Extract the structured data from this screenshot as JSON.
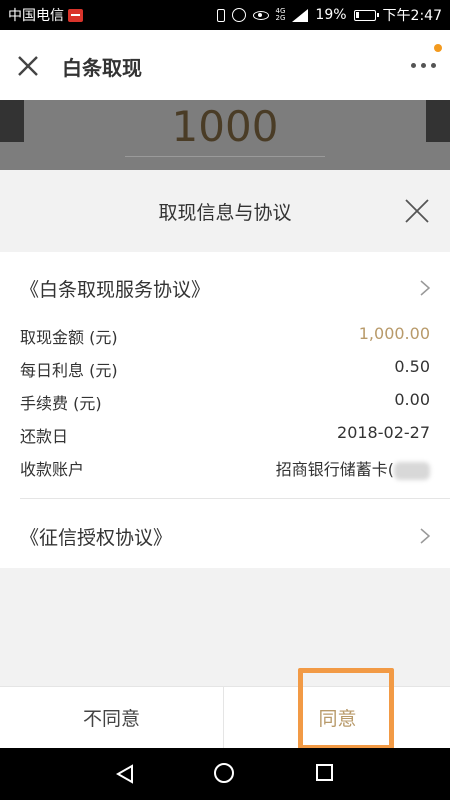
{
  "status_bar": {
    "carrier": "中国电信",
    "network_top": "4G",
    "network_bottom": "2G",
    "battery_percent": "19%",
    "battery_level": 0.19,
    "time": "下午2:47"
  },
  "header": {
    "title": "白条取现"
  },
  "background": {
    "amount": "1000"
  },
  "sheet": {
    "title": "取现信息与协议",
    "service_agreement": "《白条取现服务协议》",
    "details": [
      {
        "label": "取现金额 (元)",
        "value": "1,000.00"
      },
      {
        "label": "每日利息 (元)",
        "value": "0.50"
      },
      {
        "label": "手续费 (元)",
        "value": "0.00"
      },
      {
        "label": "还款日",
        "value": "2018-02-27"
      },
      {
        "label": "收款账户",
        "value": "招商银行储蓄卡("
      }
    ],
    "credit_agreement": "《征信授权协议》"
  },
  "buttons": {
    "disagree": "不同意",
    "agree": "同意"
  },
  "colors": {
    "accent": "#b89a6a",
    "highlight": "#f29a45",
    "notification_dot": "#f39a1e"
  }
}
